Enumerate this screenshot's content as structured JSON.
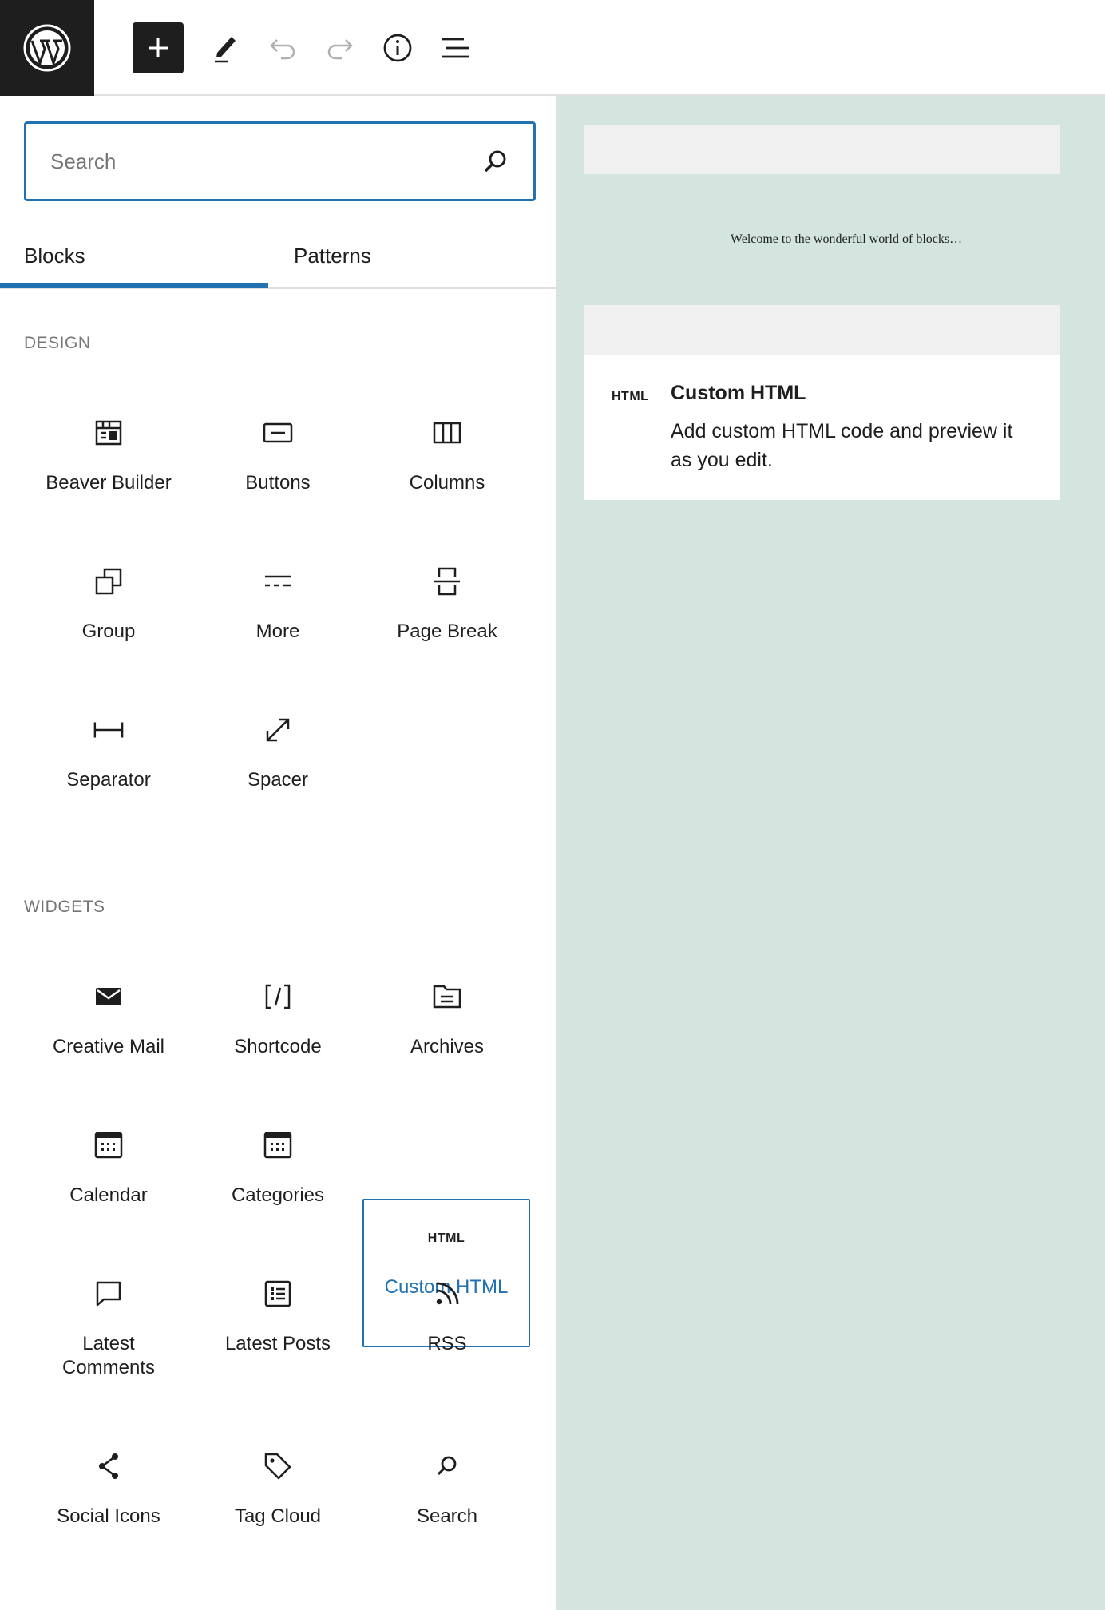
{
  "header": {
    "logo_icon": "wordpress-logo-icon",
    "buttons": [
      {
        "name": "add-block-button",
        "icon": "plus-icon"
      },
      {
        "name": "tools-button",
        "icon": "pencil-icon"
      },
      {
        "name": "undo-button",
        "icon": "undo-icon"
      },
      {
        "name": "redo-button",
        "icon": "redo-icon"
      },
      {
        "name": "details-button",
        "icon": "info-icon"
      },
      {
        "name": "outline-button",
        "icon": "list-view-icon"
      }
    ]
  },
  "inserter": {
    "search": {
      "placeholder": "Search",
      "value": ""
    },
    "tabs": [
      {
        "label": "Blocks",
        "active": true
      },
      {
        "label": "Patterns",
        "active": false
      }
    ],
    "categories": [
      {
        "title": "Design",
        "blocks": [
          {
            "label": "Beaver Builder",
            "icon": "beaver-builder-icon"
          },
          {
            "label": "Buttons",
            "icon": "buttons-icon"
          },
          {
            "label": "Columns",
            "icon": "columns-icon"
          },
          {
            "label": "Group",
            "icon": "group-icon"
          },
          {
            "label": "More",
            "icon": "more-icon"
          },
          {
            "label": "Page Break",
            "icon": "page-break-icon"
          },
          {
            "label": "Separator",
            "icon": "separator-icon"
          },
          {
            "label": "Spacer",
            "icon": "spacer-icon"
          }
        ]
      },
      {
        "title": "Widgets",
        "blocks": [
          {
            "label": "Creative Mail",
            "icon": "mail-icon"
          },
          {
            "label": "Shortcode",
            "icon": "shortcode-icon"
          },
          {
            "label": "Archives",
            "icon": "archives-icon"
          },
          {
            "label": "Calendar",
            "icon": "calendar-icon"
          },
          {
            "label": "Categories",
            "icon": "categories-icon"
          },
          {
            "label": "Custom HTML",
            "icon": "html-icon",
            "selected": true,
            "glyph": "HTML"
          },
          {
            "label": "Latest Comments",
            "icon": "comment-icon"
          },
          {
            "label": "Latest Posts",
            "icon": "latest-posts-icon"
          },
          {
            "label": "RSS",
            "icon": "rss-icon"
          },
          {
            "label": "Social Icons",
            "icon": "share-icon"
          },
          {
            "label": "Tag Cloud",
            "icon": "tag-icon"
          },
          {
            "label": "Search",
            "icon": "search-icon"
          }
        ]
      }
    ]
  },
  "preview": {
    "sample_text": "Welcome to the wonderful world of blocks…",
    "block_glyph": "HTML",
    "block_title": "Custom HTML",
    "block_description": "Add custom HTML code and preview it as you edit."
  },
  "colors": {
    "accent": "#2271b1",
    "dark": "#1e1e1e",
    "preview_bg": "#d3e5de",
    "muted": "#757575"
  }
}
